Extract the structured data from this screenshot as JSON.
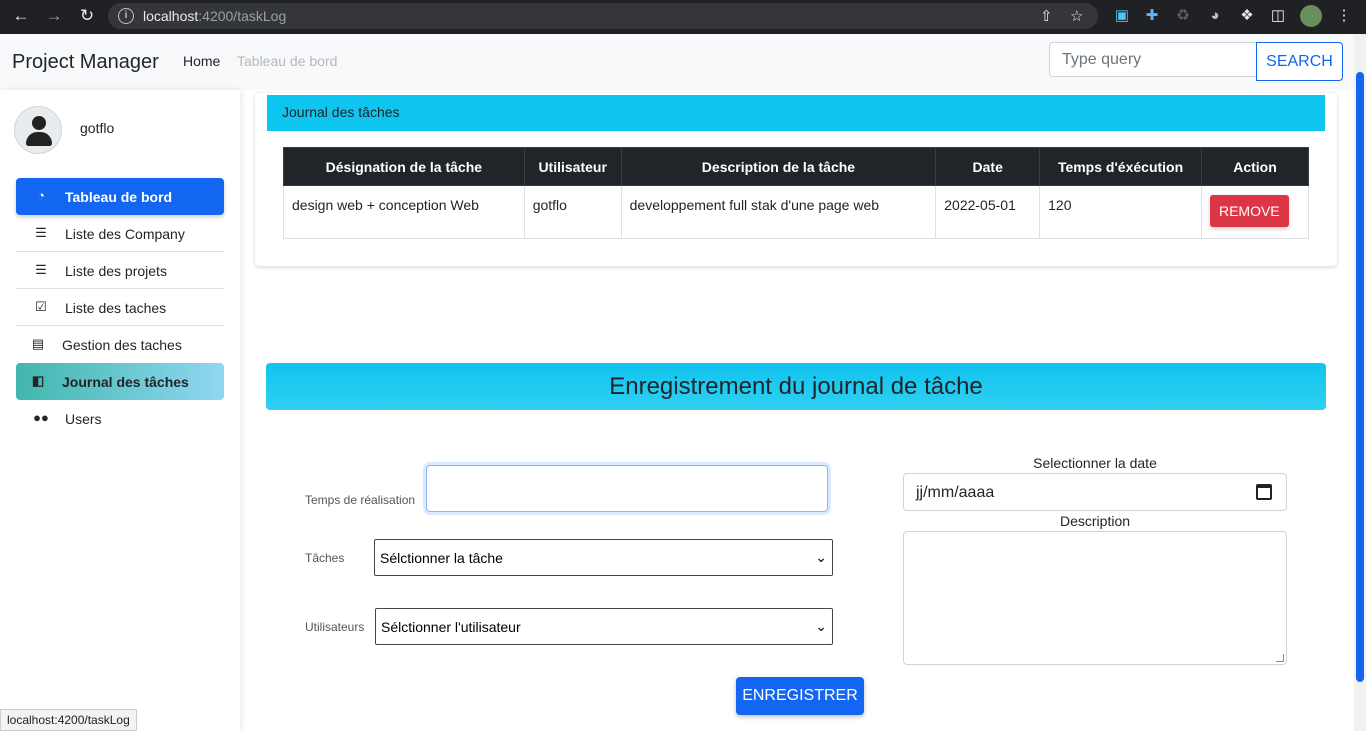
{
  "browser": {
    "url_host": "localhost",
    "url_rest": ":4200/taskLog"
  },
  "navbar": {
    "brand": "Project Manager",
    "home_label": "Home",
    "dashboard_label": "Tableau de bord",
    "search_placeholder": "Type query",
    "search_button": "SEARCH"
  },
  "sidebar": {
    "username": "gotflo",
    "items": [
      {
        "label": "Tableau de bord",
        "icon": "gauge-icon"
      },
      {
        "label": "Liste des Company",
        "icon": "list-icon"
      },
      {
        "label": "Liste des projets",
        "icon": "list-icon"
      },
      {
        "label": "Liste des taches",
        "icon": "checklist-icon"
      },
      {
        "label": "Gestion des taches",
        "icon": "clipboard-icon"
      },
      {
        "label": "Journal des tâches",
        "icon": "book-icon"
      },
      {
        "label": "Users",
        "icon": "users-icon"
      }
    ]
  },
  "log_card": {
    "title": "Journal des tâches",
    "columns": [
      "Désignation de la tâche",
      "Utilisateur",
      "Description de la tâche",
      "Date",
      "Temps d'éxécution",
      "Action"
    ],
    "rows": [
      {
        "designation": "design web + conception Web",
        "user": "gotflo",
        "description": "developpement full stak d'une page web",
        "date": "2022-05-01",
        "time": "120",
        "action": "REMOVE"
      }
    ]
  },
  "form": {
    "title": "Enregistrement du journal de tâche",
    "time_label": "Temps de réalisation",
    "task_label": "Tâches",
    "task_select": "Sélctionner la tâche",
    "user_label": "Utilisateurs",
    "user_select": "Sélctionner l'utilisateur",
    "date_label": "Selectionner la date",
    "date_placeholder": "jj/mm/aaaa",
    "description_label": "Description",
    "submit": "ENREGISTRER"
  },
  "status_bar": "localhost:4200/taskLog",
  "colors": {
    "primary": "#1266f1",
    "cyan_header": "#0ec5ef",
    "danger": "#dc3545",
    "table_head": "#212529"
  }
}
